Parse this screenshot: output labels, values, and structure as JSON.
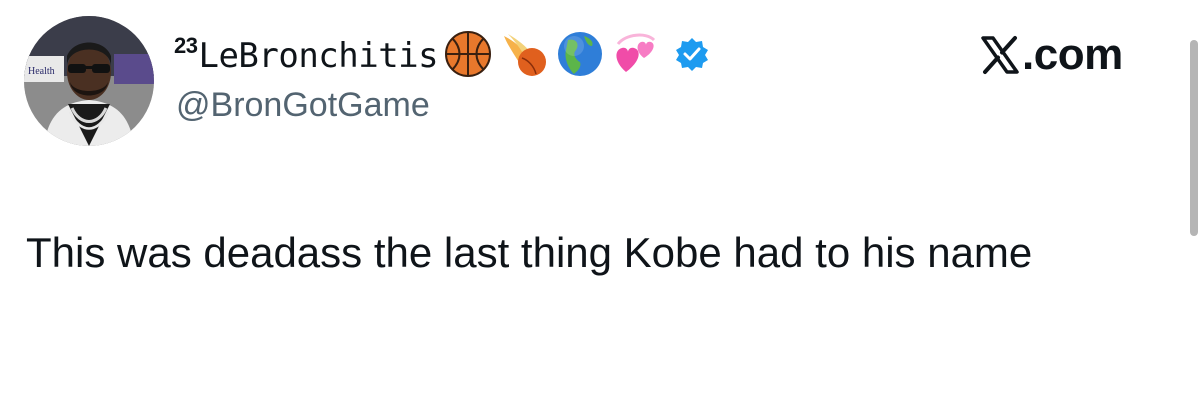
{
  "author": {
    "name_superscript": "23",
    "display_name": "LeBronchitis",
    "handle": "@BronGotGame",
    "verified": true,
    "name_emojis": [
      "basketball-emoji",
      "comet-basketball-emoji",
      "globe-americas-emoji",
      "revolving-hearts-emoji"
    ]
  },
  "source_label": ".com",
  "tweet": {
    "text": "This was deadass the last thing Kobe had to his name"
  },
  "colors": {
    "text": "#0f1419",
    "secondary": "#536471",
    "verified_blue": "#1d9bf0"
  }
}
